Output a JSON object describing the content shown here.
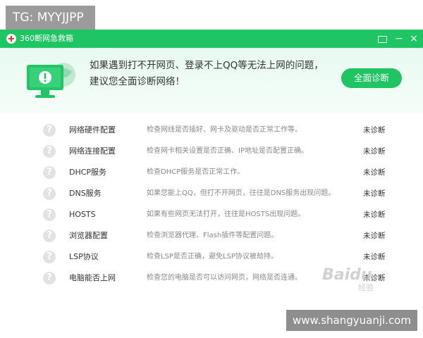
{
  "badge": {
    "text": "TG: MYYJJPP"
  },
  "window": {
    "title": "360断网急救箱",
    "buttons": {
      "feedback": "",
      "minimize": "−",
      "close": "×"
    }
  },
  "banner": {
    "line1": "如果遇到打不开网页、登录不上QQ等无法上网的问题，",
    "line2": "建议您全面诊断网络！",
    "button": "全面诊断"
  },
  "items": [
    {
      "name": "网络硬件配置",
      "desc": "检查网线是否插好、网卡及驱动是否正常工作等。",
      "status": "未诊断"
    },
    {
      "name": "网络连接配置",
      "desc": "检查网卡相关设置是否正确、IP地址是否配置正确。",
      "status": "未诊断"
    },
    {
      "name": "DHCP服务",
      "desc": "检查DHCP服务是否正常工作。",
      "status": "未诊断"
    },
    {
      "name": "DNS服务",
      "desc": "如果您能上QQ，但打不开网页，往往是DNS服务出现问题。",
      "status": "未诊断"
    },
    {
      "name": "HOSTS",
      "desc": "如果有些网页无法打开，往往是HOSTS出现问题。",
      "status": "未诊断"
    },
    {
      "name": "浏览器配置",
      "desc": "检查浏览器代理、Flash插件等配置问题。",
      "status": "未诊断"
    },
    {
      "name": "LSP协议",
      "desc": "检查LSP是否正确，避免LSP协议被劫持。",
      "status": "未诊断"
    },
    {
      "name": "电脑能否上网",
      "desc": "检查您的电脑是否可以访问网页，网络是否连通。",
      "status": "未诊断"
    }
  ],
  "icons": {
    "help": "?",
    "app": "red-cross-icon",
    "monitor": "monitor-warning-icon"
  },
  "colors": {
    "accent": "#1fc463",
    "banner_bg": "#e9faf1"
  },
  "watermarks": {
    "baidu": "Baidu",
    "jingyan": "经验",
    "site": "www.shangyuanji.com"
  }
}
